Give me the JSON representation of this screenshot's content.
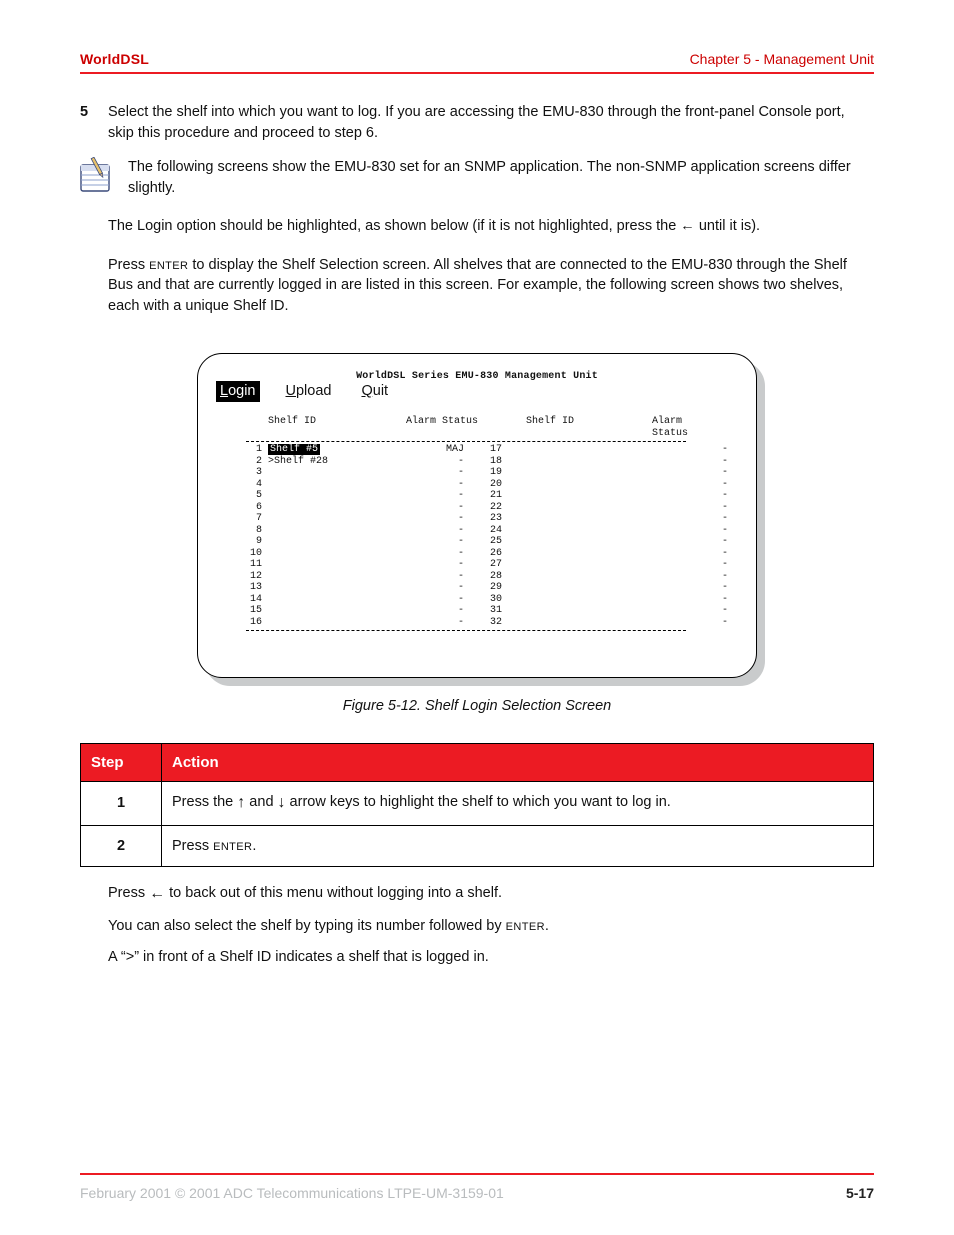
{
  "header": {
    "brand": "WorldDSL",
    "chapter": "Chapter 5 - Management Unit"
  },
  "step5": {
    "num": "5",
    "text": "Select the shelf into which you want to log. If you are accessing the EMU-830 through the front-panel Console port, skip this procedure and proceed to step 6."
  },
  "note": "The following screens show the EMU-830 set for an SNMP application. The non-SNMP application screens differ slightly.",
  "para1": "The Login option should be highlighted, as shown below (if it is not highlighted, press the ← until it is).",
  "para2_a": "Press ",
  "para2_key": "ENTER",
  "para2_b": " to display the Shelf Selection screen. All shelves that are connected to the EMU-830 through the Shelf Bus and that are currently logged in are listed in this screen. For example, the following screen shows two shelves, each with a unique Shelf ID.",
  "terminal": {
    "title": "WorldDSL Series EMU-830 Management Unit",
    "menu": {
      "login": "Login",
      "upload": "Upload",
      "quit": "Quit"
    },
    "col1h": "Shelf ID",
    "col2h": "Alarm Status",
    "col3h": "Shelf ID",
    "col4h": "Alarm Status",
    "left": [
      {
        "idx": "1",
        "id": "Shelf #5",
        "alarm": "MAJ",
        "sel": true
      },
      {
        "idx": "2",
        "id": ">Shelf #28",
        "alarm": "-"
      },
      {
        "idx": "3",
        "id": "",
        "alarm": "-"
      },
      {
        "idx": "4",
        "id": "",
        "alarm": "-"
      },
      {
        "idx": "5",
        "id": "",
        "alarm": "-"
      },
      {
        "idx": "6",
        "id": "",
        "alarm": "-"
      },
      {
        "idx": "7",
        "id": "",
        "alarm": "-"
      },
      {
        "idx": "8",
        "id": "",
        "alarm": "-"
      },
      {
        "idx": "9",
        "id": "",
        "alarm": "-"
      },
      {
        "idx": "10",
        "id": "",
        "alarm": "-"
      },
      {
        "idx": "11",
        "id": "",
        "alarm": "-"
      },
      {
        "idx": "12",
        "id": "",
        "alarm": "-"
      },
      {
        "idx": "13",
        "id": "",
        "alarm": "-"
      },
      {
        "idx": "14",
        "id": "",
        "alarm": "-"
      },
      {
        "idx": "15",
        "id": "",
        "alarm": "-"
      },
      {
        "idx": "16",
        "id": "",
        "alarm": "-"
      }
    ],
    "right": [
      {
        "idx": "17",
        "alarm": "-"
      },
      {
        "idx": "18",
        "alarm": "-"
      },
      {
        "idx": "19",
        "alarm": "-"
      },
      {
        "idx": "20",
        "alarm": "-"
      },
      {
        "idx": "21",
        "alarm": "-"
      },
      {
        "idx": "22",
        "alarm": "-"
      },
      {
        "idx": "23",
        "alarm": "-"
      },
      {
        "idx": "24",
        "alarm": "-"
      },
      {
        "idx": "25",
        "alarm": "-"
      },
      {
        "idx": "26",
        "alarm": "-"
      },
      {
        "idx": "27",
        "alarm": "-"
      },
      {
        "idx": "28",
        "alarm": "-"
      },
      {
        "idx": "29",
        "alarm": "-"
      },
      {
        "idx": "30",
        "alarm": "-"
      },
      {
        "idx": "31",
        "alarm": "-"
      },
      {
        "idx": "32",
        "alarm": "-"
      }
    ]
  },
  "fig_caption": "Figure 5-12.  Shelf Login Selection Screen",
  "table": {
    "h1": "Step",
    "h2": "Action",
    "r1_step": "1",
    "r1a": "Press the ",
    "r1b": " and ",
    "r1c": " arrow keys to highlight the shelf to which you want to log in.",
    "r2_step": "2",
    "r2a": "Press ",
    "r2_key": "ENTER",
    "r2b": "."
  },
  "after": {
    "l1a": "Press ",
    "l1b": " to back out of this menu without logging into a shelf.",
    "l2a": "You can also select the shelf by typing its number followed by ",
    "l2_key": "ENTER",
    "l2b": ".",
    "l3": "A “>” in front of a Shelf ID indicates a shelf that is logged in."
  },
  "footer": {
    "doc": "February 2001  © 2001 ADC Telecommunications  LTPE-UM-3159-01",
    "page": "5-17"
  }
}
